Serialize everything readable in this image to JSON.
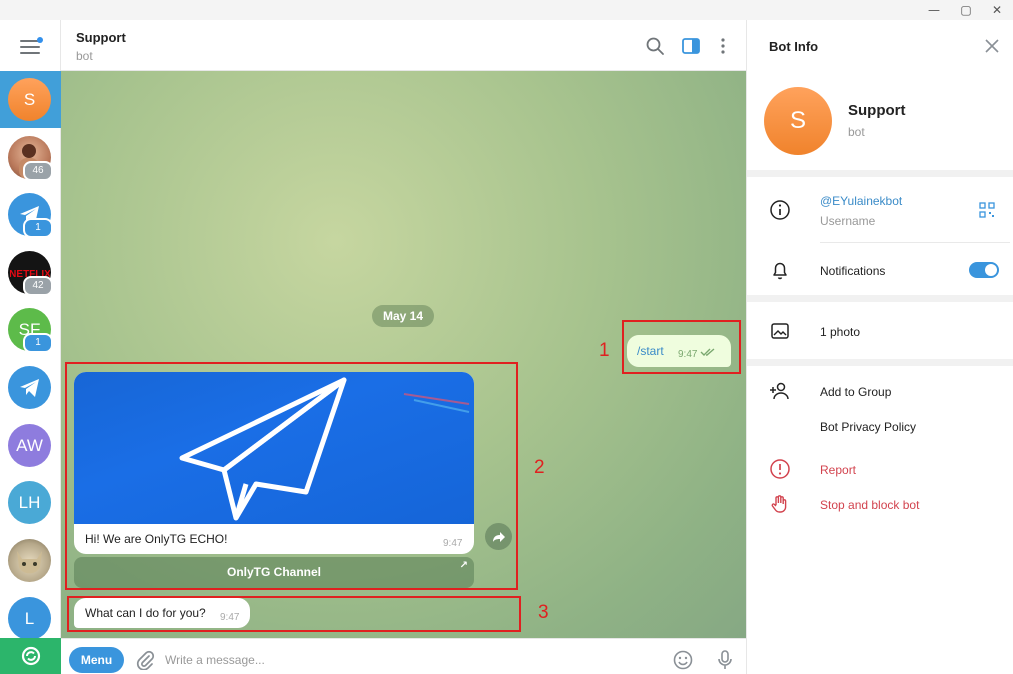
{
  "window": {
    "minimize_glyph": "—",
    "maximize_glyph": "▢",
    "close_glyph": "✕"
  },
  "sidebar": {
    "items": [
      {
        "initials": "S",
        "badge": "",
        "kind": "letter",
        "color": "#f5913b",
        "active": true
      },
      {
        "initials": "",
        "badge": "46",
        "kind": "photo",
        "color": "#c98a6a"
      },
      {
        "initials": "",
        "badge": "1",
        "kind": "telegram",
        "color": "#3a95dd"
      },
      {
        "initials": "",
        "badge": "42",
        "kind": "netflix",
        "color": "#141414"
      },
      {
        "initials": "SF",
        "badge": "1",
        "kind": "letter",
        "color": "#5dbb4a"
      },
      {
        "initials": "",
        "badge": "",
        "kind": "telegram",
        "color": "#3a95dd"
      },
      {
        "initials": "AW",
        "badge": "",
        "kind": "letter",
        "color": "#8e7cde"
      },
      {
        "initials": "LH",
        "badge": "",
        "kind": "letter",
        "color": "#4aa9d6"
      },
      {
        "initials": "",
        "badge": "",
        "kind": "cat",
        "color": "#b6a88a"
      },
      {
        "initials": "L",
        "badge": "",
        "kind": "letter",
        "color": "#3a95dd"
      }
    ]
  },
  "chat": {
    "title": "Support",
    "subtitle": "bot",
    "date_label": "May 14",
    "outgoing": {
      "text": "/start",
      "time": "9:47"
    },
    "media": {
      "caption": "Hi! We are  OnlyTG ECHO!",
      "time": "9:47"
    },
    "inline_button": {
      "label": "OnlyTG Channel",
      "arrow": "↗"
    },
    "incoming": {
      "text": "What can I do for you?",
      "time": "9:47"
    }
  },
  "annotations": [
    "1",
    "2",
    "3"
  ],
  "composer": {
    "menu_label": "Menu",
    "placeholder": "Write a message..."
  },
  "info": {
    "title": "Bot Info",
    "avatar_initial": "S",
    "name": "Support",
    "subtitle": "bot",
    "username": "@EYulainekbot",
    "username_caption": "Username",
    "notifications_label": "Notifications",
    "notifications_on": true,
    "photos_label": "1 photo",
    "add_to_group": "Add to Group",
    "privacy_policy": "Bot Privacy Policy",
    "report": "Report",
    "stop_block": "Stop and block bot"
  },
  "colors": {
    "accent": "#3a95dd",
    "danger": "#d2434e",
    "annotation": "#e02020"
  }
}
